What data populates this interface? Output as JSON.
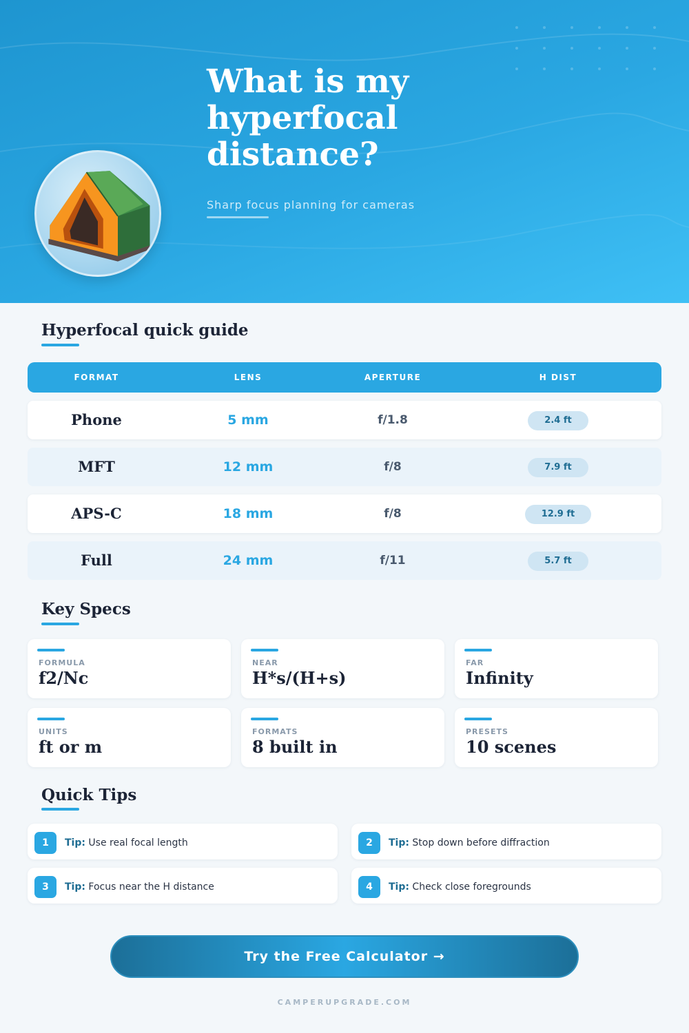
{
  "hero": {
    "title": "What is my hyperfocal distance?",
    "subtitle": "Sharp focus planning for cameras",
    "image_icon": "tent-icon"
  },
  "guide": {
    "title": "Hyperfocal quick guide",
    "headers": [
      "FORMAT",
      "LENS",
      "APERTURE",
      "H DIST"
    ],
    "rows": [
      {
        "format": "Phone",
        "lens": "5 mm",
        "aperture": "f/1.8",
        "hdist": "2.4 ft"
      },
      {
        "format": "MFT",
        "lens": "12 mm",
        "aperture": "f/8",
        "hdist": "7.9 ft"
      },
      {
        "format": "APS-C",
        "lens": "18 mm",
        "aperture": "f/8",
        "hdist": "12.9 ft"
      },
      {
        "format": "Full",
        "lens": "24 mm",
        "aperture": "f/11",
        "hdist": "5.7 ft"
      }
    ]
  },
  "specs": {
    "title": "Key Specs",
    "items": [
      {
        "label": "FORMULA",
        "value": "f2/Nc"
      },
      {
        "label": "NEAR",
        "value": "H*s/(H+s)"
      },
      {
        "label": "FAR",
        "value": "Infinity"
      },
      {
        "label": "UNITS",
        "value": "ft or m"
      },
      {
        "label": "FORMATS",
        "value": "8 built in"
      },
      {
        "label": "PRESETS",
        "value": "10 scenes"
      }
    ]
  },
  "tips": {
    "title": "Quick Tips",
    "prefix": "Tip:",
    "items": [
      {
        "num": "1",
        "text": "Use real focal length"
      },
      {
        "num": "2",
        "text": "Stop down before diffraction"
      },
      {
        "num": "3",
        "text": "Focus near the H distance"
      },
      {
        "num": "4",
        "text": "Check close foregrounds"
      }
    ]
  },
  "cta": {
    "label": "Try the Free Calculator →"
  },
  "footer": {
    "text": "CAMPERUPGRADE.COM"
  },
  "colors": {
    "accent": "#2aa7e2",
    "dark": "#1c2436",
    "pill_bg": "#cfe5f3",
    "page_bg": "#f3f7fa"
  }
}
